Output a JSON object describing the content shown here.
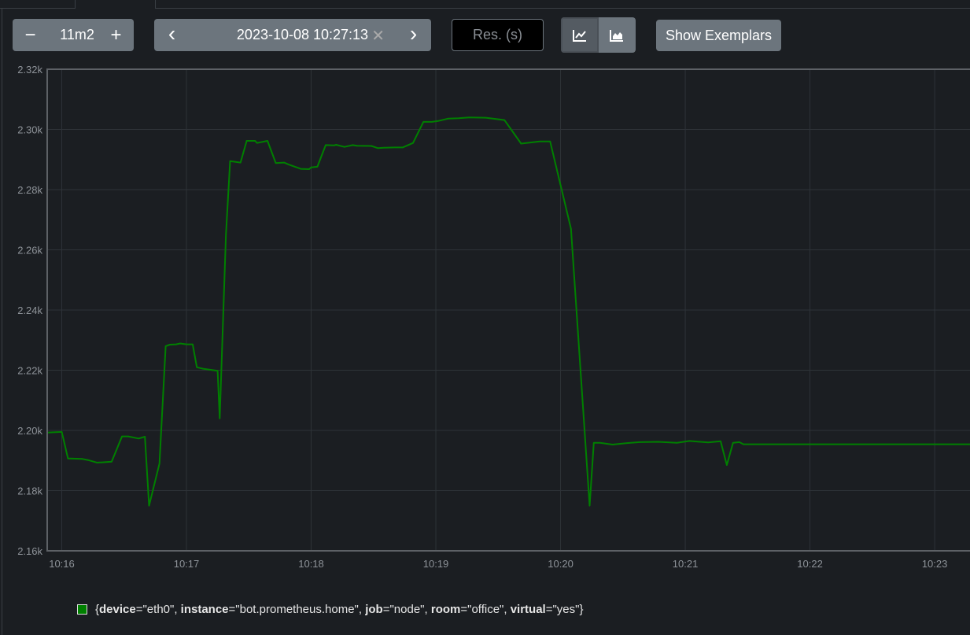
{
  "controls": {
    "range_value": "11m2",
    "minus_label": "−",
    "plus_label": "+",
    "end_time": "2023-10-08 10:27:13",
    "clear_label": "✕",
    "prev_label": "‹",
    "next_label": "›",
    "resolution_placeholder": "Res. (s)",
    "line_chart_icon": "line-chart-icon",
    "stacked_chart_icon": "area-chart-icon",
    "show_exemplars_label": "Show Exemplars"
  },
  "colors": {
    "series": "#008000",
    "background": "#1b1e22",
    "grid": "#2e3338",
    "axis": "#6c7075",
    "button": "#6c757d"
  },
  "legend": {
    "open": "{",
    "close": "}",
    "labels": [
      {
        "key": "device",
        "value": "\"eth0\""
      },
      {
        "key": "instance",
        "value": "\"bot.prometheus.home\""
      },
      {
        "key": "job",
        "value": "\"node\""
      },
      {
        "key": "room",
        "value": "\"office\""
      },
      {
        "key": "virtual",
        "value": "\"yes\""
      }
    ]
  },
  "chart_data": {
    "type": "line",
    "title": "",
    "xlabel": "",
    "ylabel": "",
    "grid": true,
    "legend_placement": "bottom-left",
    "x_ticks": [
      "10:16",
      "10:17",
      "10:18",
      "10:19",
      "10:20",
      "10:21",
      "10:22",
      "10:23"
    ],
    "y_ticks": [
      "2.16k",
      "2.18k",
      "2.20k",
      "2.22k",
      "2.24k",
      "2.26k",
      "2.28k",
      "2.30k",
      "2.32k"
    ],
    "xlim": [
      "10:15:53",
      "10:23:17"
    ],
    "ylim": [
      2160,
      2320
    ],
    "series": [
      {
        "name": "{device=\"eth0\", instance=\"bot.prometheus.home\", job=\"node\", room=\"office\", virtual=\"yes\"}",
        "x": [
          "10:15:53",
          "10:16:00",
          "10:16:03",
          "10:16:10",
          "10:16:13",
          "10:16:17",
          "10:16:20",
          "10:16:24",
          "10:16:29",
          "10:16:32",
          "10:16:37",
          "10:16:40",
          "10:16:42",
          "10:16:47",
          "10:16:50",
          "10:16:52",
          "10:16:55",
          "10:16:57",
          "10:17:00",
          "10:17:03",
          "10:17:05",
          "10:17:08",
          "10:17:11",
          "10:17:15",
          "10:17:16",
          "10:17:19",
          "10:17:21",
          "10:17:26",
          "10:17:29",
          "10:17:33",
          "10:17:34",
          "10:17:39",
          "10:17:43",
          "10:17:47",
          "10:17:49",
          "10:17:55",
          "10:17:59",
          "10:18:00",
          "10:18:03",
          "10:18:07",
          "10:18:11",
          "10:18:12",
          "10:18:16",
          "10:18:20",
          "10:18:22",
          "10:18:29",
          "10:18:32",
          "10:18:35",
          "10:18:40",
          "10:18:44",
          "10:18:49",
          "10:18:54",
          "10:18:58",
          "10:19:01",
          "10:19:06",
          "10:19:11",
          "10:19:16",
          "10:19:24",
          "10:19:33",
          "10:19:41",
          "10:19:50",
          "10:19:55",
          "10:20:05",
          "10:20:14",
          "10:20:16",
          "10:20:19",
          "10:20:25",
          "10:20:32",
          "10:20:38",
          "10:20:47",
          "10:20:56",
          "10:21:02",
          "10:21:11",
          "10:21:17",
          "10:21:20",
          "10:21:23",
          "10:21:26",
          "10:21:28",
          "10:21:31",
          "10:21:36",
          "10:21:40",
          "10:21:45",
          "10:21:48",
          "10:21:53",
          "10:21:57",
          "10:22:00",
          "10:22:04",
          "10:22:14",
          "10:22:24",
          "10:22:34",
          "10:22:44",
          "10:22:51",
          "10:22:56",
          "10:22:58",
          "10:23:00",
          "10:23:03",
          "10:23:07",
          "10:23:10",
          "10:23:17"
        ],
        "values": [
          2199.3,
          2199.5,
          2190.7,
          2190.5,
          2190.1,
          2189.3,
          2189.4,
          2189.6,
          2198.0,
          2198.0,
          2197.3,
          2197.9,
          2175.0,
          2189.0,
          2228.0,
          2228.5,
          2228.6,
          2228.9,
          2228.6,
          2228.6,
          2221.0,
          2220.5,
          2220.2,
          2219.8,
          2204.0,
          2265.0,
          2289.5,
          2289.0,
          2296.2,
          2296.2,
          2295.5,
          2296.2,
          2288.8,
          2289.0,
          2288.4,
          2286.9,
          2286.8,
          2287.4,
          2287.6,
          2294.8,
          2294.7,
          2294.9,
          2294.2,
          2294.8,
          2294.6,
          2294.5,
          2293.8,
          2293.9,
          2294.0,
          2294.0,
          2295.5,
          2302.5,
          2302.5,
          2302.8,
          2303.6,
          2303.7,
          2304.0,
          2303.9,
          2303.1,
          2295.3,
          2296.0,
          2296.0,
          2267.0,
          2175.0,
          2195.9,
          2195.9,
          2195.3,
          2195.8,
          2196.1,
          2196.2,
          2195.9,
          2196.5,
          2196.0,
          2196.4,
          2188.5,
          2195.9,
          2196.1,
          2195.4,
          2195.4,
          2195.4,
          2195.4,
          2195.4,
          2195.4,
          2195.4,
          2195.4,
          2195.4,
          2195.4,
          2195.4,
          2195.4,
          2195.4,
          2195.4,
          2195.4,
          2195.4,
          2195.4,
          2195.4,
          2195.4,
          2195.4,
          2195.4,
          2195.4
        ]
      }
    ]
  }
}
